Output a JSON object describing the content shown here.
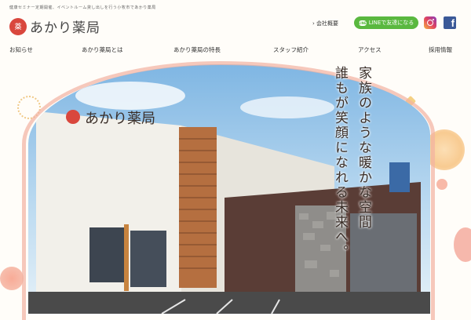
{
  "header": {
    "tagline": "健康セミナー定期開催、イベントルーム貸し出しを行う小牧市であかり薬局",
    "logo_mark": "薬",
    "logo_text": "あかり薬局",
    "company_link": "会社概要",
    "line_button": "LINEで友達になる",
    "line_bubble": "LINE"
  },
  "nav": {
    "items": [
      "お知らせ",
      "あかり薬局とは",
      "あかり薬局の特長",
      "スタッフ紹介",
      "アクセス",
      "採用情報"
    ]
  },
  "hero": {
    "catch_line1": "家族のような暖かな空間",
    "catch_line2": "誰もが笑顔になれる未来へ。",
    "sign_text": "あかり薬局"
  },
  "colors": {
    "accent": "#d9473d",
    "line_green": "#5ab83f",
    "facebook": "#3b5998"
  },
  "icons": [
    "chevron-right-icon",
    "line-icon",
    "instagram-icon",
    "facebook-icon"
  ]
}
